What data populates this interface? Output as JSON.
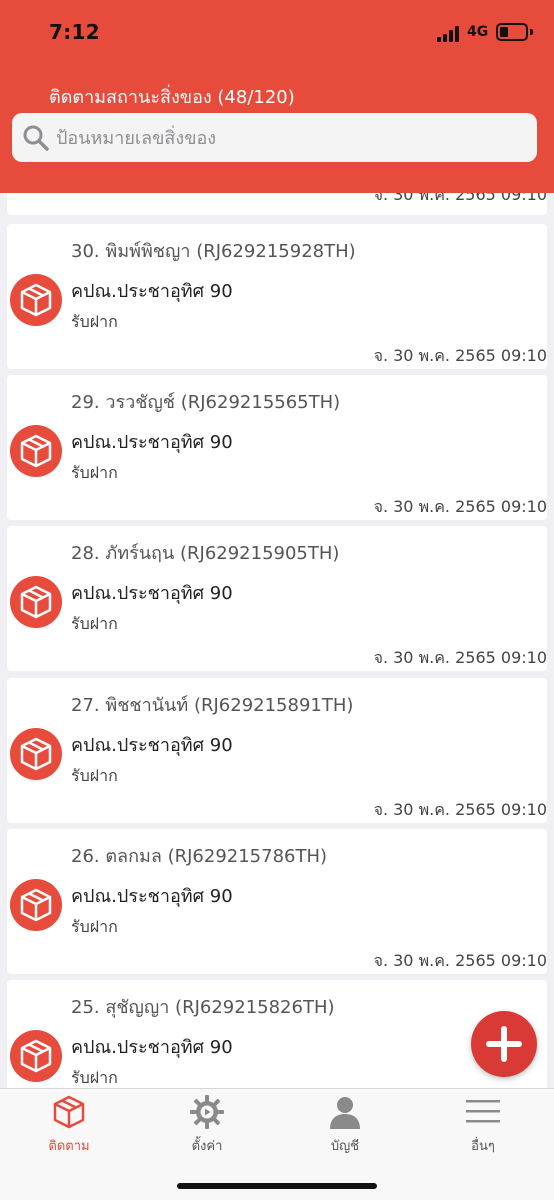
{
  "status_bar": {
    "time": "7:12",
    "network": "4G"
  },
  "header": {
    "title": "ติดตามสถานะสิ่งของ (48/120)",
    "search_placeholder": "ป้อนหมายเลขสิ่งของ"
  },
  "list": {
    "partial_item_date": "จ. 30 พ.ค. 2565 09:10",
    "items": [
      {
        "title": "30. พิมพ์พิชญา (RJ629215928TH)",
        "office": "คปณ.ประชาอุทิศ 90",
        "status": "รับฝาก",
        "date": "จ. 30 พ.ค. 2565 09:10"
      },
      {
        "title": "29. วรวชัญช์ (RJ629215565TH)",
        "office": "คปณ.ประชาอุทิศ 90",
        "status": "รับฝาก",
        "date": "จ. 30 พ.ค. 2565 09:10"
      },
      {
        "title": "28. ภัทร์นฤน (RJ629215905TH)",
        "office": "คปณ.ประชาอุทิศ 90",
        "status": "รับฝาก",
        "date": "จ. 30 พ.ค. 2565 09:10"
      },
      {
        "title": "27. พิชชานันท์ (RJ629215891TH)",
        "office": "คปณ.ประชาอุทิศ 90",
        "status": "รับฝาก",
        "date": "จ. 30 พ.ค. 2565 09:10"
      },
      {
        "title": "26. ตลกมล (RJ629215786TH)",
        "office": "คปณ.ประชาอุทิศ 90",
        "status": "รับฝาก",
        "date": "จ. 30 พ.ค. 2565 09:10"
      },
      {
        "title": "25. สุชัญญา (RJ629215826TH)",
        "office": "คปณ.ประชาอุทิศ 90",
        "status": "รับฝาก",
        "date": ""
      }
    ]
  },
  "tabs": [
    {
      "label": "ติดตาม",
      "icon": "box-icon",
      "active": true
    },
    {
      "label": "ตั้งค่า",
      "icon": "gear-icon",
      "active": false
    },
    {
      "label": "บัญชี",
      "icon": "person-icon",
      "active": false
    },
    {
      "label": "อื่นๆ",
      "icon": "menu-icon",
      "active": false
    }
  ],
  "colors": {
    "primary": "#e74b3c",
    "fab": "#d93a35",
    "background": "#efeff4"
  }
}
